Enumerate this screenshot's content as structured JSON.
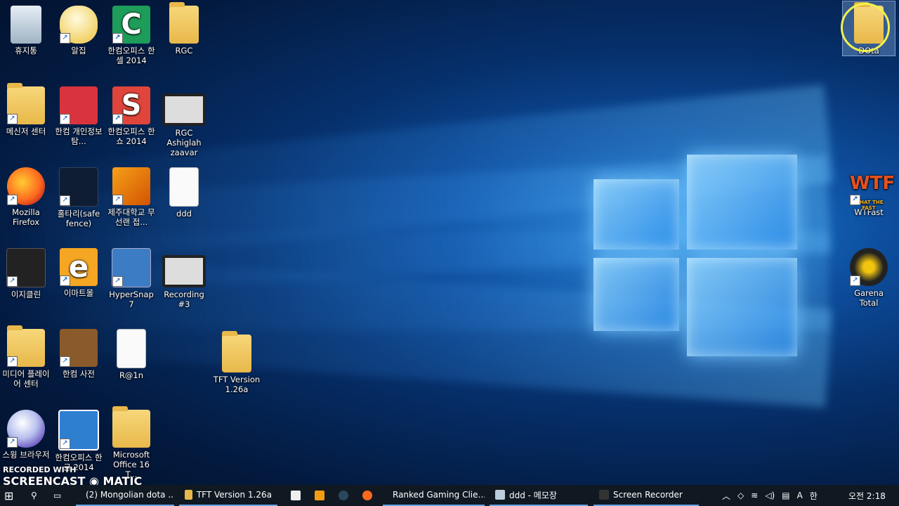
{
  "desktop_icons": [
    {
      "label": "휴지통"
    },
    {
      "label": "알집"
    },
    {
      "label": "한컴오피스 한셀 2014"
    },
    {
      "label": "RGC"
    },
    {
      "label": "메신저 센터"
    },
    {
      "label": "한컴 개인정보탐..."
    },
    {
      "label": "한컴오피스 한쇼 2014"
    },
    {
      "label": "RGC Ashiglah zaavar"
    },
    {
      "label": "Mozilla Firefox"
    },
    {
      "label": "홀타리(safe fence)"
    },
    {
      "label": "제주대학교 무선랜 접..."
    },
    {
      "label": "ddd"
    },
    {
      "label": "이지클린"
    },
    {
      "label": "이마트몰"
    },
    {
      "label": "HyperSnap 7"
    },
    {
      "label": "Recording #3"
    },
    {
      "label": "미디어 플레이어 센터"
    },
    {
      "label": "한컴 사전"
    },
    {
      "label": "R@1n"
    },
    {
      "label": "TFT Version 1.26a"
    },
    {
      "label": "스윙 브라우저"
    },
    {
      "label": "한컴오피스 한글 2014"
    },
    {
      "label": "Microsoft Office 16 T..."
    },
    {
      "label": "DOta"
    },
    {
      "label": "WTFast"
    },
    {
      "label": "Garena Total"
    }
  ],
  "wtf_logo_text": "WTF",
  "wtf_logo_sub": "WHAT THE FAST",
  "watermark": {
    "line1": "RECORDED WITH",
    "line2": "SCREENCAST",
    "line3": "MATIC"
  },
  "taskbar": {
    "tasks": [
      {
        "label": "(2) Mongolian dota ..."
      },
      {
        "label": "TFT Version 1.26a"
      },
      {
        "label": "Ranked Gaming Clie..."
      },
      {
        "label": "ddd - 메모장"
      },
      {
        "label": "Screen Recorder"
      }
    ],
    "ime": "A",
    "ime2": "한",
    "clock": "오전 2:18"
  },
  "colors": {
    "taskbar": "#101922",
    "selection_ring": "#f1f24a",
    "folder": "#e8b84a"
  }
}
